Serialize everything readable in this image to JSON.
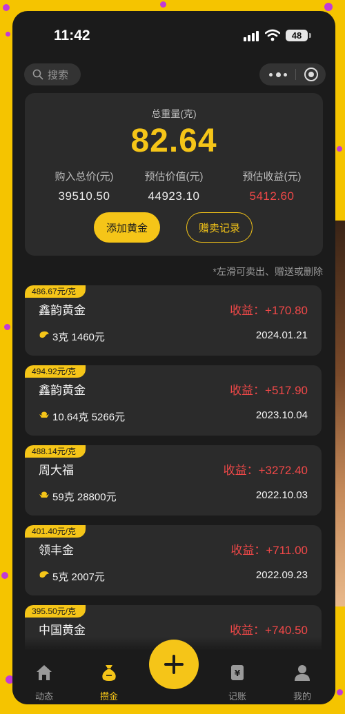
{
  "status": {
    "time": "11:42",
    "battery": "48"
  },
  "search": {
    "label": "搜索"
  },
  "summary": {
    "total_weight_label": "总重量(克)",
    "total_weight": "82.64",
    "purchase_total_label": "购入总价(元)",
    "purchase_total": "39510.50",
    "estimated_value_label": "预估价值(元)",
    "estimated_value": "44923.10",
    "estimated_profit_label": "预估收益(元)",
    "estimated_profit": "5412.60",
    "add_button": "添加黄金",
    "record_button": "赠卖记录"
  },
  "hint": "*左滑可卖出、赠送或删除",
  "items": [
    {
      "price": "486.67元/克",
      "name": "鑫韵黄金",
      "profit": "收益：+170.80",
      "weight": "3克 1460元",
      "date": "2024.01.21",
      "icon": "gold-bean-icon"
    },
    {
      "price": "494.92元/克",
      "name": "鑫韵黄金",
      "profit": "收益：+517.90",
      "weight": "10.64克 5266元",
      "date": "2023.10.04",
      "icon": "gold-ingot-icon"
    },
    {
      "price": "488.14元/克",
      "name": "周大福",
      "profit": "收益：+3272.40",
      "weight": "59克 28800元",
      "date": "2022.10.03",
      "icon": "gold-ingot-icon"
    },
    {
      "price": "401.40元/克",
      "name": "领丰金",
      "profit": "收益：+711.00",
      "weight": "5克 2007元",
      "date": "2022.09.23",
      "icon": "gold-bean-icon"
    },
    {
      "price": "395.50元/克",
      "name": "中国黄金",
      "profit": "收益：+740.50",
      "weight": "",
      "date": "",
      "icon": "gold-bean-icon"
    }
  ],
  "tabs": [
    {
      "label": "动态",
      "icon": "home-icon",
      "active": false
    },
    {
      "label": "攒金",
      "icon": "money-bag-icon",
      "active": true
    },
    {
      "label": "记账",
      "icon": "ledger-icon",
      "active": false
    },
    {
      "label": "我的",
      "icon": "user-icon",
      "active": false
    }
  ],
  "colors": {
    "accent": "#f5c518",
    "profit": "#f04848",
    "background": "#1b1b1b",
    "card": "#2b2b2b"
  }
}
